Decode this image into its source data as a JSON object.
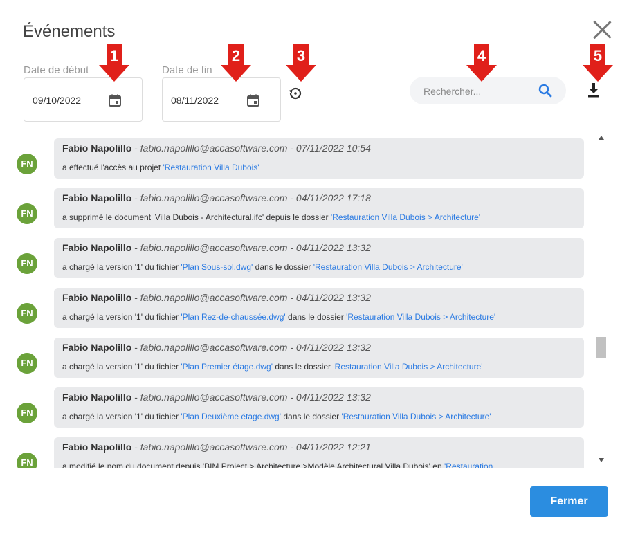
{
  "dialog": {
    "title": "Événements",
    "close_icon": "close-icon"
  },
  "filters": {
    "start_label": "Date de début",
    "start_value": "09/10/2022",
    "end_label": "Date de fin",
    "end_value": "08/11/2022",
    "calendar_icon": "calendar-icon",
    "reset_icon": "history-reset-icon",
    "search_placeholder": "Rechercher...",
    "search_icon": "search-icon",
    "download_icon": "download-icon"
  },
  "annotations": [
    "1",
    "2",
    "3",
    "4",
    "5"
  ],
  "colors": {
    "annotation_red": "#e0201a",
    "avatar_green": "#6ba23a",
    "link_blue": "#2a7ae2",
    "button_blue": "#2b8de0"
  },
  "events": [
    {
      "initials": "FN",
      "author": "Fabio Napolillo",
      "email": "fabio.napolillo@accasoftware.com",
      "timestamp": "07/11/2022 10:54",
      "parts": [
        {
          "text": "a effectué l'accès au projet ",
          "link": false
        },
        {
          "text": "'Restauration Villa Dubois'",
          "link": true
        }
      ]
    },
    {
      "initials": "FN",
      "author": "Fabio Napolillo",
      "email": "fabio.napolillo@accasoftware.com",
      "timestamp": "04/11/2022 17:18",
      "parts": [
        {
          "text": "a supprimé le document 'Villa Dubois - Architectural.ifc' depuis le dossier ",
          "link": false
        },
        {
          "text": "'Restauration Villa Dubois > Architecture'",
          "link": true
        }
      ]
    },
    {
      "initials": "FN",
      "author": "Fabio Napolillo",
      "email": "fabio.napolillo@accasoftware.com",
      "timestamp": "04/11/2022 13:32",
      "parts": [
        {
          "text": "a chargé la version '1' du fichier ",
          "link": false
        },
        {
          "text": "'Plan Sous-sol.dwg'",
          "link": true
        },
        {
          "text": " dans le dossier ",
          "link": false
        },
        {
          "text": "'Restauration Villa Dubois > Architecture'",
          "link": true
        }
      ]
    },
    {
      "initials": "FN",
      "author": "Fabio Napolillo",
      "email": "fabio.napolillo@accasoftware.com",
      "timestamp": "04/11/2022 13:32",
      "parts": [
        {
          "text": "a chargé la version '1' du fichier ",
          "link": false
        },
        {
          "text": "'Plan Rez-de-chaussée.dwg'",
          "link": true
        },
        {
          "text": " dans le dossier ",
          "link": false
        },
        {
          "text": "'Restauration Villa Dubois > Architecture'",
          "link": true
        }
      ]
    },
    {
      "initials": "FN",
      "author": "Fabio Napolillo",
      "email": "fabio.napolillo@accasoftware.com",
      "timestamp": "04/11/2022 13:32",
      "parts": [
        {
          "text": "a chargé la version '1' du fichier ",
          "link": false
        },
        {
          "text": "'Plan Premier étage.dwg'",
          "link": true
        },
        {
          "text": " dans le dossier ",
          "link": false
        },
        {
          "text": "'Restauration Villa Dubois > Architecture'",
          "link": true
        }
      ]
    },
    {
      "initials": "FN",
      "author": "Fabio Napolillo",
      "email": "fabio.napolillo@accasoftware.com",
      "timestamp": "04/11/2022 13:32",
      "parts": [
        {
          "text": "a chargé la version '1' du fichier ",
          "link": false
        },
        {
          "text": "'Plan Deuxième étage.dwg'",
          "link": true
        },
        {
          "text": " dans le dossier ",
          "link": false
        },
        {
          "text": "'Restauration Villa Dubois > Architecture'",
          "link": true
        }
      ]
    },
    {
      "initials": "FN",
      "author": "Fabio Napolillo",
      "email": "fabio.napolillo@accasoftware.com",
      "timestamp": "04/11/2022 12:21",
      "parts": [
        {
          "text": "a modifié le nom du document depuis 'BIM Project > Architecture >Modèle Architectural Villa Dubois' en ",
          "link": false
        },
        {
          "text": "'Restauration",
          "link": true
        }
      ]
    }
  ],
  "footer": {
    "close_label": "Fermer"
  }
}
